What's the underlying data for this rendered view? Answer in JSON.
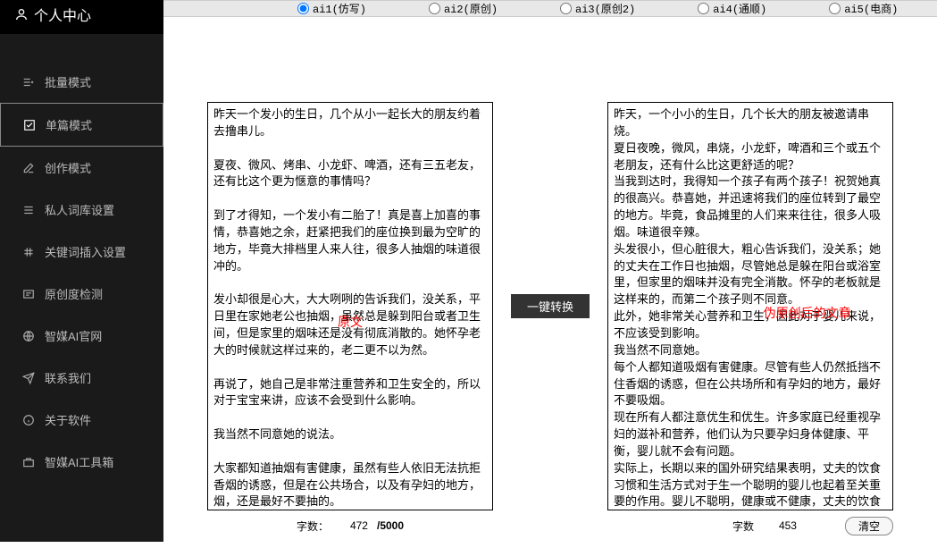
{
  "header": {
    "title": "个人中心"
  },
  "sidebar": [
    {
      "label": "批量模式",
      "icon": "batch"
    },
    {
      "label": "单篇模式",
      "icon": "single"
    },
    {
      "label": "创作模式",
      "icon": "create"
    },
    {
      "label": "私人词库设置",
      "icon": "dict"
    },
    {
      "label": "关键词插入设置",
      "icon": "keyword"
    },
    {
      "label": "原创度检测",
      "icon": "check"
    },
    {
      "label": "智媒AI官网",
      "icon": "globe"
    },
    {
      "label": "联系我们",
      "icon": "contact"
    },
    {
      "label": "关于软件",
      "icon": "about"
    },
    {
      "label": "智媒AI工具箱",
      "icon": "toolbox"
    }
  ],
  "radios": [
    {
      "label": "ai1(仿写)",
      "checked": true
    },
    {
      "label": "ai2(原创)",
      "checked": false
    },
    {
      "label": "ai3(原创2)",
      "checked": false
    },
    {
      "label": "ai4(通顺)",
      "checked": false
    },
    {
      "label": "ai5(电商)",
      "checked": false
    }
  ],
  "left": {
    "overlay": "原文",
    "text": "昨天一个发小的生日，几个从小一起长大的朋友约着去撸串儿。\n\n夏夜、微风、烤串、小龙虾、啤酒，还有三五老友，还有比这个更为惬意的事情吗？\n\n到了才得知，一个发小有二胎了！真是喜上加喜的事情，恭喜她之余，赶紧把我们的座位换到最为空旷的地方，毕竟大排档里人来人往，很多人抽烟的味道很冲的。\n\n发小却很是心大，大大咧咧的告诉我们，没关系，平日里在家她老公也抽烟，虽然总是躲到阳台或者卫生间，但是家里的烟味还是没有彻底消散的。她怀孕老大的时候就这样过来的，老二更不以为然。\n\n再说了，她自己是非常注重营养和卫生安全的，所以对于宝宝来讲，应该不会受到什么影响。\n\n我当然不同意她的说法。\n\n大家都知道抽烟有害健康，虽然有些人依旧无法抗拒香烟的诱惑，但是在公共场合，以及有孕妇的地方，烟，还是最好不要抽的。\n\n现在都讲究优生优育，很多家庭把重点都放到了对孕妈妈的滋补、营养等方面，以为只要孕妈妈身体健康、营养均衡，胎宝宝就没有问题。",
    "count_label": "字数：",
    "count_value": "472",
    "count_max": "/5000"
  },
  "center": {
    "button": "一键转换"
  },
  "right": {
    "overlay": "伪原创后的文章",
    "text": "昨天，一个小小的生日，几个长大的朋友被邀请串烧。\n夏日夜晚，微风，串烧，小龙虾，啤酒和三个或五个老朋友，还有什么比这更舒适的呢？\n当我到达时，我得知一个孩子有两个孩子！祝贺她真的很高兴。恭喜她，并迅速将我们的座位转到了最空的地方。毕竟，食品摊里的人们来来往往，很多人吸烟。味道很辛辣。\n头发很小，但心脏很大，粗心告诉我们，没关系；她的丈夫在工作日也抽烟，尽管她总是躲在阳台或浴室里，但家里的烟味并没有完全消散。怀孕的老板就是这样来的，而第二个孩子则不同意。\n此外，她非常关心营养和卫生，因此对于婴儿来说，不应该受到影响。\n我当然不同意她。\n每个人都知道吸烟有害健康。尽管有些人仍然抵挡不住香烟的诱惑，但在公共场所和有孕妇的地方，最好不要吸烟。\n现在所有人都注意优生和优生。许多家庭已经重视孕妇的滋补和营养，他们认为只要孕妇身体健康、平衡，婴儿就不会有问题。\n实际上，长期以来的国外研究结果表明，丈夫的饮食习惯和生活方式对于生一个聪明的婴儿也起着至关重要的作用。婴儿不聪明，健康或不健康，丈夫的饮食不能马虎。",
    "count_label": "字数",
    "count_value": "453",
    "clear": "清空"
  }
}
